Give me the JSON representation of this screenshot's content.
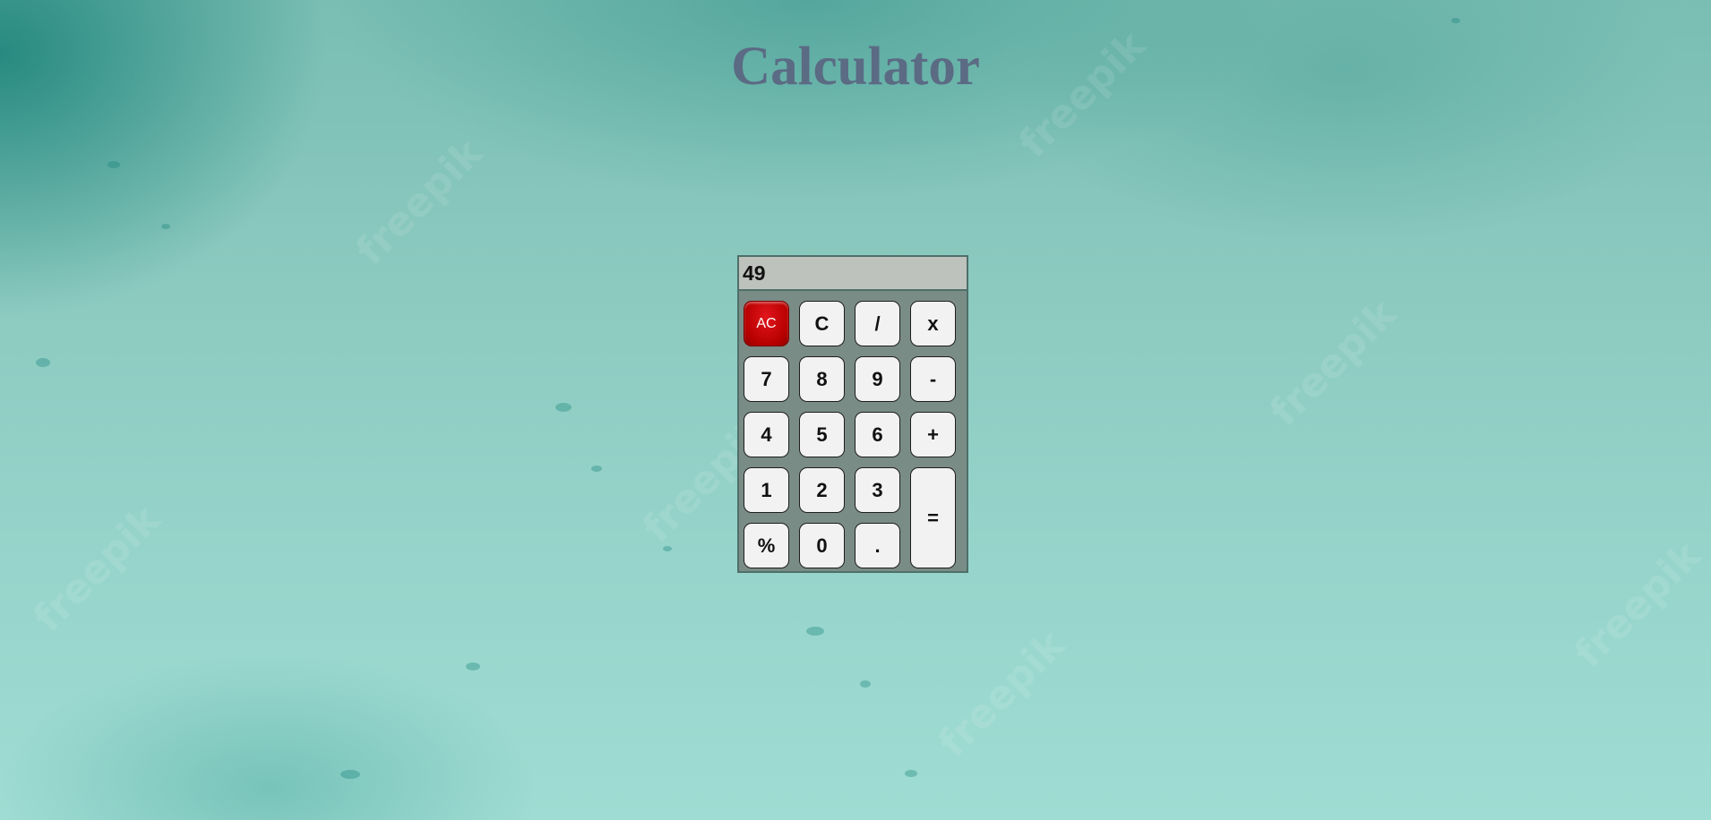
{
  "page": {
    "title": "Calculator",
    "background_color": "#8ccac0",
    "watermark_text": "freepik"
  },
  "calculator": {
    "display_value": "49",
    "keys": {
      "ac": "AC",
      "clear": "C",
      "divide": "/",
      "multiply": "x",
      "seven": "7",
      "eight": "8",
      "nine": "9",
      "minus": "-",
      "four": "4",
      "five": "5",
      "six": "6",
      "plus": "+",
      "one": "1",
      "two": "2",
      "three": "3",
      "equals": "=",
      "percent": "%",
      "zero": "0",
      "decimal": "."
    },
    "colors": {
      "body": "#7a8c86",
      "display": "#bec2bd",
      "ac_button": "#c40000",
      "key": "#f2f2f2"
    }
  }
}
